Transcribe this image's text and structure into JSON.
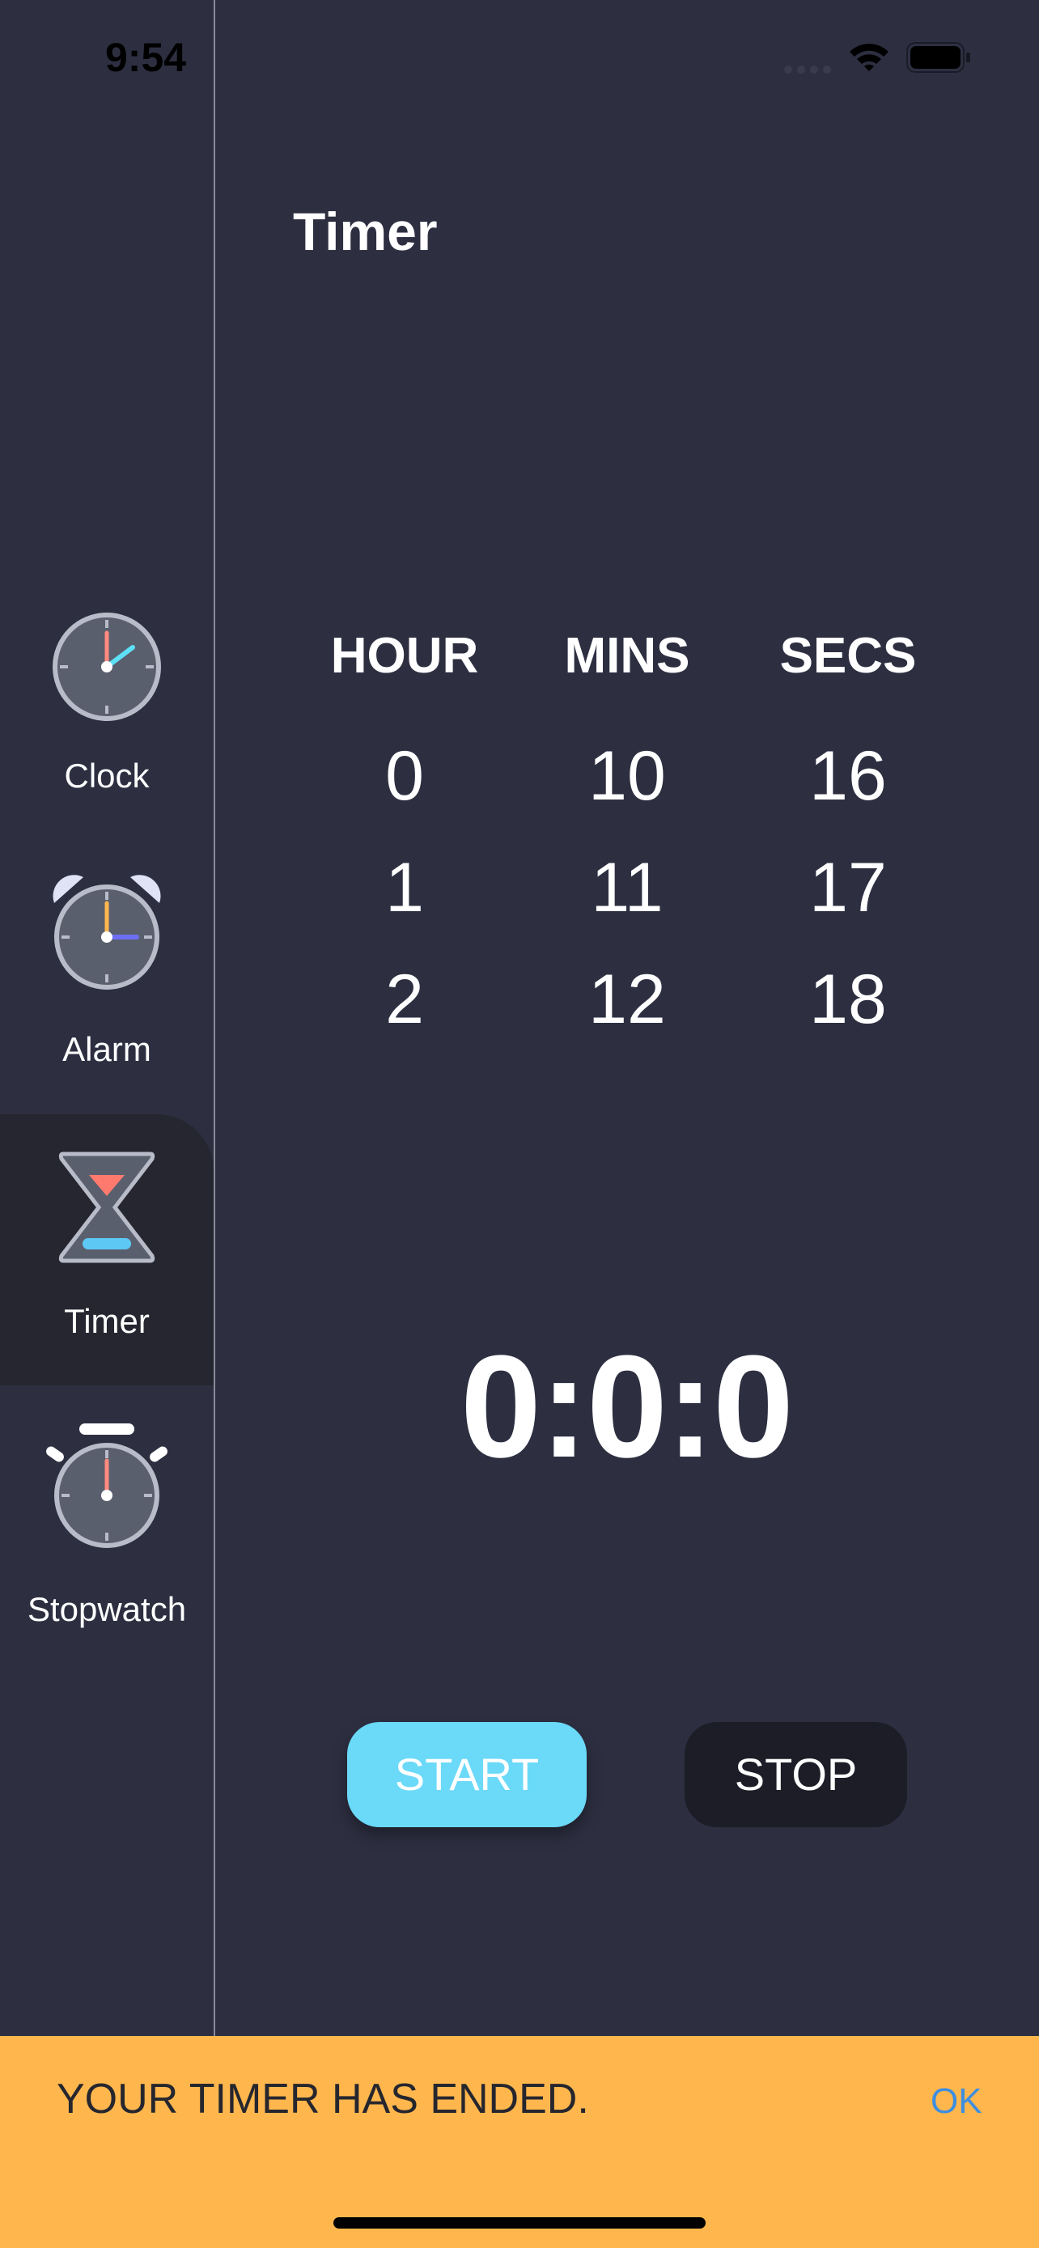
{
  "status_bar": {
    "time": "9:54"
  },
  "sidebar": {
    "items": [
      {
        "label": "Clock",
        "icon": "clock-icon"
      },
      {
        "label": "Alarm",
        "icon": "alarm-clock-icon"
      },
      {
        "label": "Timer",
        "icon": "hourglass-icon",
        "active": true
      },
      {
        "label": "Stopwatch",
        "icon": "stopwatch-icon"
      }
    ]
  },
  "page": {
    "title": "Timer"
  },
  "picker": {
    "columns": [
      {
        "header": "HOUR",
        "values": [
          "0",
          "1",
          "2"
        ]
      },
      {
        "header": "MINS",
        "values": [
          "10",
          "11",
          "12"
        ]
      },
      {
        "header": "SECS",
        "values": [
          "16",
          "17",
          "18"
        ]
      }
    ]
  },
  "timer_display": "0:0:0",
  "buttons": {
    "start": "START",
    "stop": "STOP"
  },
  "banner": {
    "message": "YOUR TIMER HAS ENDED.",
    "ok": "OK"
  },
  "colors": {
    "background": "#2d2f41",
    "start_button": "#6bd9f8",
    "stop_button": "#1c1d26",
    "banner": "#ffb74d",
    "ok_link": "#3d8ee0"
  }
}
